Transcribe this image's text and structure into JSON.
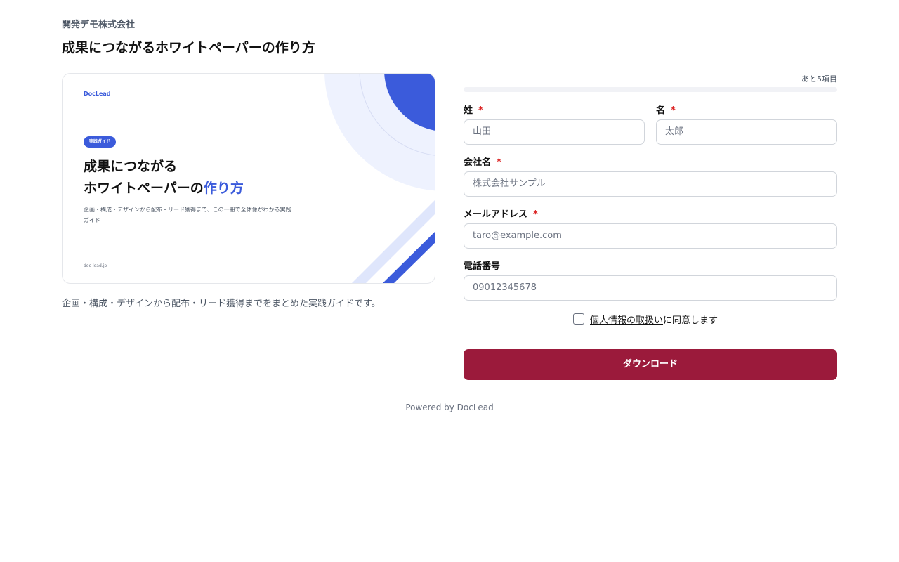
{
  "company_name": "開発デモ株式会社",
  "page_title": "成果につながるホワイトペーパーの作り方",
  "cover": {
    "brand": "DocLead",
    "badge": "実践ガイド",
    "title_line1": "成果につながる",
    "title_line2_main": "ホワイトペーパーの",
    "title_line2_accent": "作り方",
    "description": "企画・構成・デザインから配布・リード獲得まで、この一冊で全体像がわかる実践ガイド",
    "domain": "doc-lead.jp",
    "accent_color": "#3b5bdb"
  },
  "left_caption": "企画・構成・デザインから配布・リード獲得までをまとめた実践ガイドです。",
  "form": {
    "progress_label": "あと5項目",
    "progress_value": 0,
    "fields": {
      "last_name": {
        "label": "姓",
        "required_mark": "*",
        "placeholder": "山田"
      },
      "first_name": {
        "label": "名",
        "required_mark": "*",
        "placeholder": "太郎"
      },
      "company": {
        "label": "会社名",
        "required_mark": "*",
        "placeholder": "株式会社サンプル"
      },
      "email": {
        "label": "メールアドレス",
        "required_mark": "*",
        "placeholder": "taro@example.com"
      },
      "phone": {
        "label": "電話番号",
        "placeholder": "09012345678"
      }
    },
    "consent": {
      "link_text": "個人情報の取扱い",
      "suffix": "に同意します",
      "checked": false
    },
    "submit_label": "ダウンロード",
    "button_color": "#9b1a3b"
  },
  "footer": "Powered by DocLead"
}
